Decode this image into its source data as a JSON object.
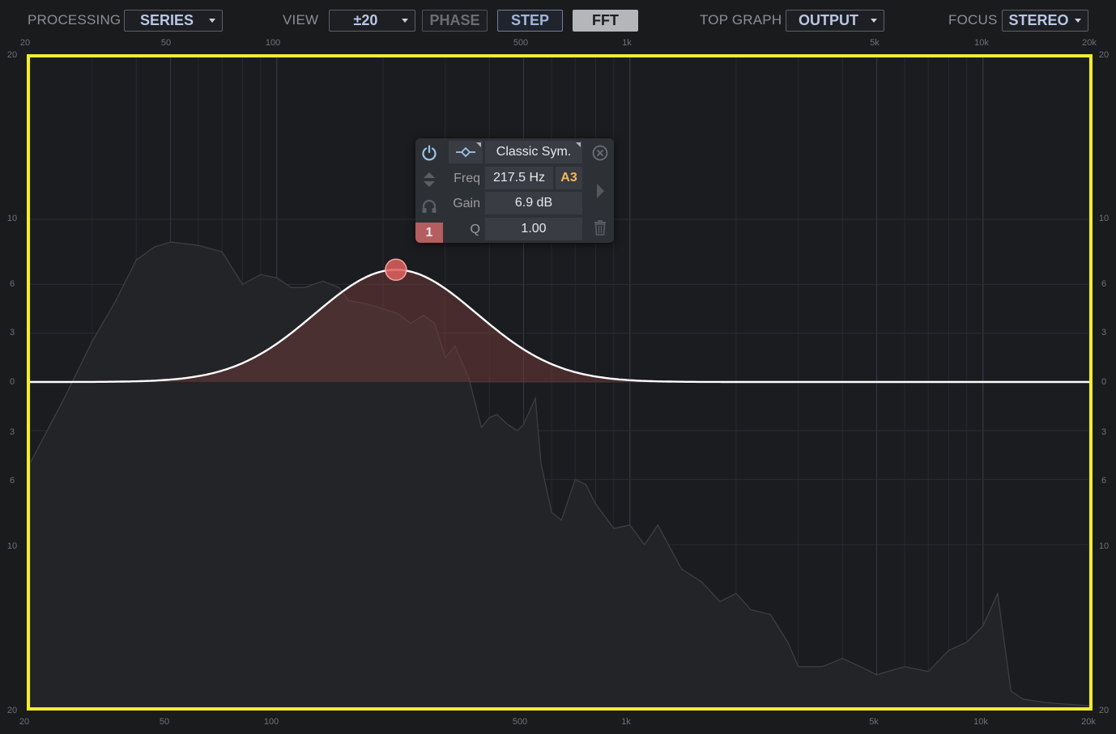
{
  "toolbar": {
    "processing_label": "PROCESSING",
    "processing_value": "SERIES",
    "view_label": "VIEW",
    "range_value": "±20",
    "phase_label": "PHASE",
    "step_label": "STEP",
    "fft_label": "FFT",
    "top_graph_label": "TOP GRAPH",
    "top_graph_value": "OUTPUT",
    "focus_label": "FOCUS",
    "focus_value": "STEREO"
  },
  "freq_labels": [
    "20",
    "50",
    "100",
    "500",
    "1k",
    "5k",
    "10k",
    "20k"
  ],
  "db_labels": [
    "20",
    "10",
    "6",
    "3",
    "0",
    "3",
    "6",
    "10",
    "20"
  ],
  "band": {
    "number": "1",
    "shape": "Classic Sym.",
    "freq_label": "Freq",
    "freq_value": "217.5 Hz",
    "note": "A3",
    "gain_label": "Gain",
    "gain_value": "6.9 dB",
    "q_label": "Q",
    "q_value": "1.00",
    "freq_hz": 217.5,
    "gain_db": 6.9,
    "q": 1.0
  },
  "colors": {
    "graph_border": "#f3ec2f",
    "eq_curve": "#ffffff",
    "eq_fill": "#6e3a39",
    "node": "#e0605f",
    "spectrum": "#3c3e43",
    "band_badge": "#b45e60",
    "note": "#f1b75f"
  },
  "chart_data": {
    "type": "line",
    "x_scale": "log",
    "xlim": [
      20,
      20000
    ],
    "ylim": [
      -20,
      20
    ],
    "x_ticks": [
      20,
      50,
      100,
      500,
      1000,
      5000,
      10000,
      20000
    ],
    "y_ticks": [
      20,
      10,
      6,
      3,
      0,
      -3,
      -6,
      -10,
      -20
    ],
    "series": [
      {
        "kind": "spectrum",
        "x": [
          20,
          25,
          30,
          35,
          40,
          45,
          50,
          55,
          60,
          70,
          80,
          90,
          100,
          110,
          120,
          135,
          150,
          160,
          180,
          200,
          220,
          240,
          260,
          280,
          300,
          320,
          350,
          380,
          400,
          420,
          450,
          480,
          500,
          540,
          560,
          600,
          640,
          700,
          750,
          800,
          900,
          1000,
          1100,
          1200,
          1400,
          1600,
          1800,
          2000,
          2200,
          2500,
          2800,
          3000,
          3500,
          4000,
          4500,
          5000,
          6000,
          7000,
          8000,
          9000,
          10000,
          11000,
          12000,
          13000,
          14000,
          15000,
          17000,
          20000
        ],
        "y": [
          -5,
          -1,
          2.5,
          5,
          7.5,
          8.3,
          8.6,
          8.5,
          8.4,
          8.0,
          6.0,
          6.6,
          6.4,
          5.8,
          5.8,
          6.2,
          5.8,
          5.0,
          4.8,
          4.5,
          4.2,
          3.6,
          4.1,
          3.6,
          1.5,
          2.2,
          0.2,
          -2.8,
          -2.2,
          -2.0,
          -2.6,
          -3.0,
          -2.6,
          -1.0,
          -5.0,
          -8.0,
          -8.5,
          -6.0,
          -6.3,
          -7.5,
          -9.0,
          -8.8,
          -10.0,
          -8.8,
          -11.5,
          -12.3,
          -13.5,
          -13.0,
          -14.0,
          -14.3,
          -16.0,
          -17.5,
          -17.5,
          -17.0,
          -17.5,
          -18.0,
          -17.5,
          -17.8,
          -16.5,
          -16.0,
          -15.0,
          -13.0,
          -19.0,
          -19.5,
          -19.6,
          -19.7,
          -19.8,
          -19.9
        ]
      }
    ]
  }
}
